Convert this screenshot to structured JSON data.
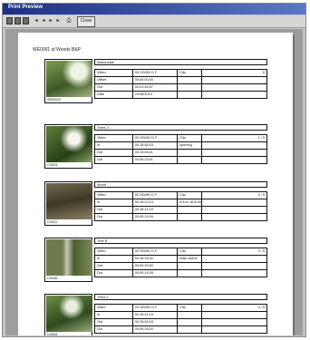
{
  "window": {
    "title": "Print Preview"
  },
  "toolbar": {
    "close_label": "Close",
    "arrows": [
      "◂",
      "◂",
      "▸",
      "▸"
    ],
    "print_glyph": "⎙"
  },
  "document": {
    "title": "WE0001 of Woods B&P",
    "clips": [
      {
        "name": "Island walk",
        "caption": "WE0003",
        "rows": [
          [
            "Video",
            "00 HD/HD D F",
            "Clip",
            "6"
          ],
          [
            "Offset",
            "00:00:00:00",
            "",
            ""
          ],
          [
            "Out",
            "00:01:46:57",
            "",
            ""
          ],
          [
            "Date",
            "20/08/2014",
            "",
            ""
          ]
        ]
      },
      {
        "name": "Trees 2",
        "caption": "C0023",
        "rows": [
          [
            "Video",
            "00 HD/HD D F",
            "Clip",
            "1 / 5"
          ],
          [
            "In",
            "00:15:46:18",
            "opening",
            ""
          ],
          [
            "Out",
            "00:15:08:21",
            "",
            ""
          ],
          [
            "Dur",
            "00:00:23:01",
            "",
            ""
          ]
        ]
      },
      {
        "name": "Wood",
        "caption": "C0031",
        "rows": [
          [
            "Video",
            "00 HD/HD D F",
            "Clip",
            "2 / 5"
          ],
          [
            "In",
            "00:15:02:14",
            "b.a.m. at le entrance",
            ""
          ],
          [
            "Out",
            "00:15:21:19",
            "",
            ""
          ],
          [
            "Dur",
            "00:00:19:04",
            "",
            ""
          ]
        ]
      },
      {
        "name": "Tree B",
        "caption": "C0036",
        "rows": [
          [
            "Video",
            "00 HD/HD D F",
            "Clip",
            "3 / 5"
          ],
          [
            "In",
            "00:16:15:02",
            "main scene",
            ""
          ],
          [
            "Out",
            "00:00:20:00",
            "",
            ""
          ],
          [
            "Dur",
            "00:00:14:28",
            "",
            ""
          ]
        ]
      },
      {
        "name": "Trees 1",
        "caption": "C0053",
        "rows": [
          [
            "Video",
            "00 HD/HD D F",
            "Clip",
            "4 / 5"
          ],
          [
            "In",
            "00:15:21:19",
            "",
            ""
          ],
          [
            "Out",
            "00:15:46:18",
            "",
            ""
          ],
          [
            "Dur",
            "00:00:25:00",
            "",
            ""
          ]
        ]
      }
    ]
  },
  "colors": {
    "titlebar": "#1e2f86",
    "frame": "#c4c4c4",
    "canvas": "#9d9d9d"
  }
}
